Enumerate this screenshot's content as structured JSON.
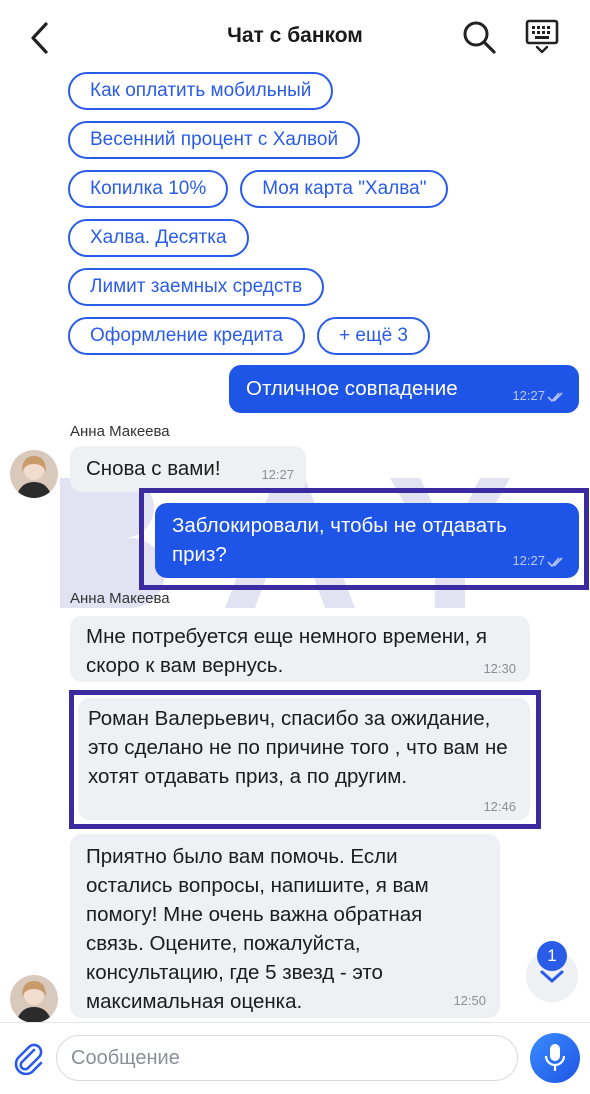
{
  "header": {
    "title": "Чат с банком",
    "back_icon": "chevron-left-icon",
    "search_icon": "search-icon",
    "keyboard_icon": "keyboard-icon"
  },
  "quick_replies": [
    [
      "Как оплатить мобильный"
    ],
    [
      "Весенний процент с Халвой"
    ],
    [
      "Копилка 10%",
      "Моя карта \"Халва\""
    ],
    [
      "Халва. Десятка"
    ],
    [
      "Лимит заемных средств"
    ],
    [
      "Оформление кредита",
      "+ ещё 3"
    ]
  ],
  "messages": [
    {
      "direction": "out",
      "text": "Отличное совпадение",
      "time": "12:27",
      "read": true
    },
    {
      "direction": "in",
      "sender": "Анна Макеева",
      "text": "Снова с вами!",
      "time": "12:27"
    },
    {
      "direction": "out",
      "text": "Заблокировали, чтобы не отдавать приз?",
      "time": "12:27",
      "read": true,
      "highlighted": true
    },
    {
      "direction": "in",
      "sender": "Анна Макеева",
      "text": "Мне потребуется еще немного времени, я скоро к вам вернусь.",
      "time": "12:30"
    },
    {
      "direction": "in",
      "text": "Роман Валерьевич, спасибо за ожидание, это сделано не по причине того , что вам не хотят отдавать приз, а по другим.",
      "time": "12:46",
      "highlighted": true
    },
    {
      "direction": "in",
      "text": "Приятно было вам помочь. Если остались вопросы, напишите, я вам помогу! Мне очень важна обратная связь. Оцените, пожалуйста, консультацию, где 5 звезд - это максимальная оценка.",
      "time": "12:50"
    }
  ],
  "scroll_down": {
    "badge": "1",
    "icon": "chevron-down-icon"
  },
  "input_bar": {
    "placeholder": "Сообщение",
    "value": "",
    "attach_icon": "paperclip-icon",
    "mic_icon": "microphone-icon"
  },
  "colors": {
    "accent": "#2a5ce8",
    "outgoing_bubble": "#1f55e6",
    "incoming_bubble": "#eef0f4",
    "highlight_frame": "#3c2aa0"
  }
}
